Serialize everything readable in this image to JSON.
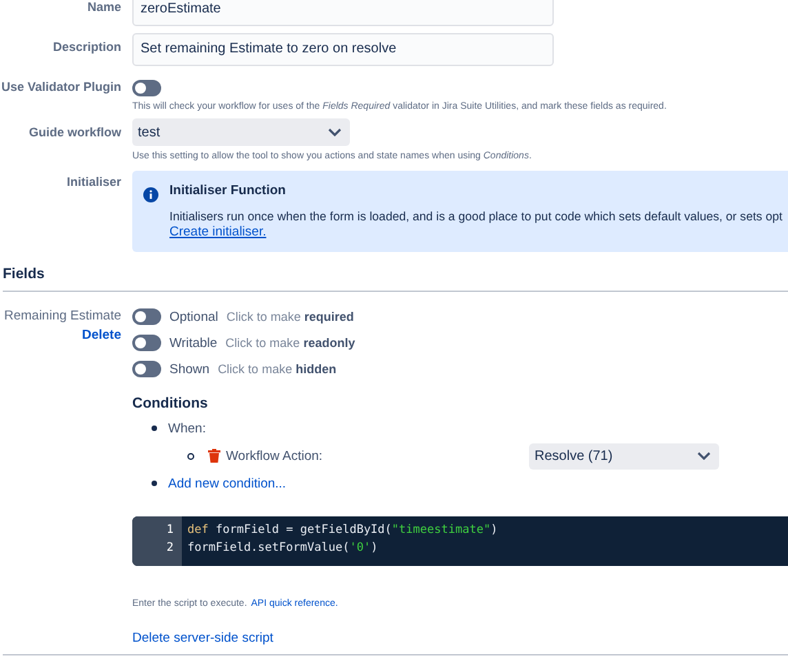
{
  "settings": [
    {
      "kind": "input",
      "label": "Name",
      "value": "zeroEstimate"
    },
    {
      "kind": "input",
      "label": "Description",
      "value": "Set remaining Estimate to zero on resolve"
    },
    {
      "kind": "toggle",
      "label": "Use Validator Plugin",
      "on": false,
      "help": "This will check your workflow for uses of the *Fields Required* validator in Jira Suite Utilities, and mark these fields as required."
    },
    {
      "kind": "select",
      "label": "Guide workflow",
      "value": "test",
      "help": "Use this setting to allow the tool to show you actions and state names when using *Conditions*."
    },
    {
      "kind": "info",
      "label": "Initialiser",
      "title": "Initialiser Function",
      "text": "Initialisers run once when the form is loaded, and is a good place to put code which sets default values, or sets opt",
      "link": "Create initialiser."
    }
  ],
  "fields_heading": "Fields",
  "field": {
    "name": "Remaining Estimate",
    "delete": "Delete",
    "toggles": [
      {
        "label": "Optional",
        "hint": "Click to make",
        "action": "required",
        "on": false
      },
      {
        "label": "Writable",
        "hint": "Click to make",
        "action": "readonly",
        "on": false
      },
      {
        "label": "Shown",
        "hint": "Click to make",
        "action": "hidden",
        "on": false
      }
    ],
    "conditions_heading": "Conditions",
    "when": "When:",
    "condition": {
      "label": "Workflow Action:",
      "value": "Resolve (71)"
    },
    "add_condition": "Add new condition...",
    "code": [
      {
        "number": "1",
        "tokens": [
          {
            "kind": "keyword",
            "text": "def"
          },
          {
            "kind": "plain",
            "text": " formField = getFieldById("
          },
          {
            "kind": "string",
            "text": "\"timeestimate\""
          },
          {
            "kind": "plain",
            "text": ")"
          }
        ]
      },
      {
        "number": "2",
        "tokens": [
          {
            "kind": "plain",
            "text": "formField.setFormValue("
          },
          {
            "kind": "string",
            "text": "'0'"
          },
          {
            "kind": "plain",
            "text": ")"
          }
        ]
      }
    ],
    "script_help": "Enter the script to execute.",
    "api_link": "API quick reference.",
    "delete_script": "Delete server-side script"
  }
}
